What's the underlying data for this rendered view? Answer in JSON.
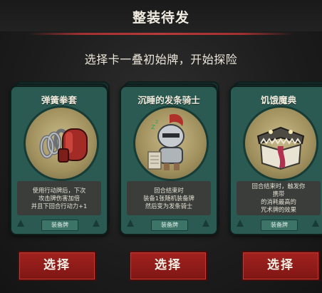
{
  "header": {
    "title": "整装待发"
  },
  "subtitle": "选择卡一叠初始牌，开始探险",
  "cards": [
    {
      "name": "弹簧拳套",
      "desc": [
        "使用行动牌后，下次",
        "攻击牌伤害加倍",
        "并且下回合行动力+1"
      ],
      "tag": "装备牌",
      "button": "选择"
    },
    {
      "name": "沉睡的发条骑士",
      "desc": [
        "回合结束时",
        "装备1张随机装备牌",
        "然后变为发条骑士"
      ],
      "tag": "装备牌",
      "button": "选择"
    },
    {
      "name": "饥饿魔典",
      "desc": [
        "回合结束时，触发你",
        "携带的消耗最高的",
        "咒术牌的效果"
      ],
      "desc_highlight": "携带",
      "tag": "装备牌",
      "button": "选择"
    }
  ],
  "colors": {
    "card_green": "#2a5a52",
    "button_red": "#a2221f",
    "highlight": "#e2b73e"
  }
}
